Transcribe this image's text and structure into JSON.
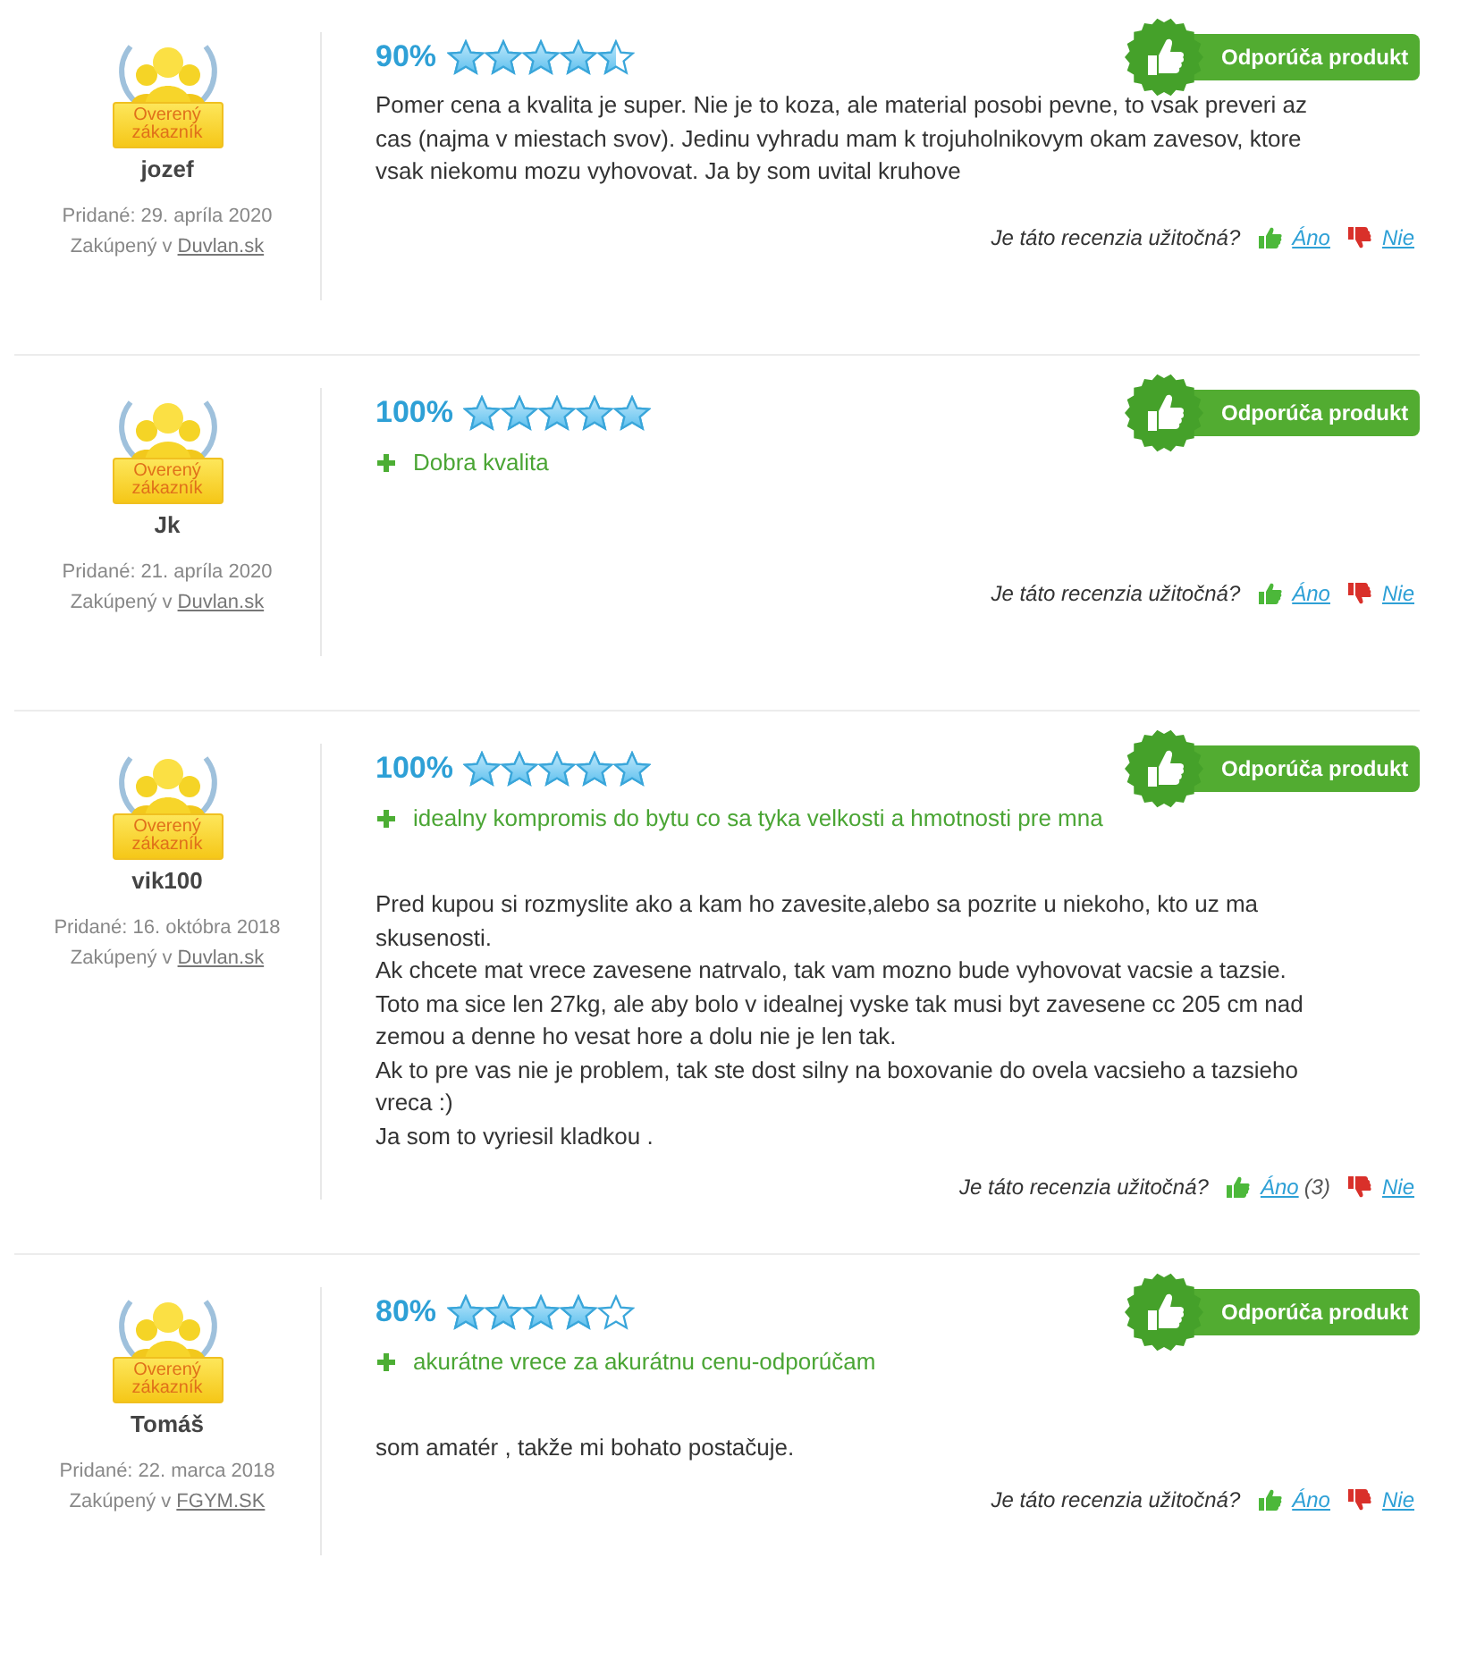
{
  "reviews": [
    {
      "verified_badge": "Overený zákazník",
      "author": "jozef",
      "added": "Pridané: 29. apríla 2020",
      "purchased_label": "Zakúpený v",
      "shop": "Duvlan.sk",
      "percent": "90%",
      "stars": 4.5,
      "recommends": true,
      "recommend_label": "Odporúča produkt",
      "body": [
        "Pomer cena a kvalita je super. Nie je to koza, ale material posobi pevne, to vsak preveri az cas (najma v miestach svov). Jedinu vyhradu mam k trojuholnikovym okam zavesov, ktore vsak niekomu mozu vyhovovat. Ja by som uvital kruhove"
      ],
      "helpful_question": "Je táto recenzia užitočná?",
      "yes": "Áno",
      "no": "Nie"
    },
    {
      "verified_badge": "Overený zákazník",
      "author": "Jk",
      "added": "Pridané: 21. apríla 2020",
      "purchased_label": "Zakúpený v",
      "shop": "Duvlan.sk",
      "percent": "100%",
      "stars": 5,
      "recommends": true,
      "recommend_label": "Odporúča produkt",
      "pros": [
        "Dobra kvalita"
      ],
      "helpful_question": "Je táto recenzia užitočná?",
      "yes": "Áno",
      "no": "Nie"
    },
    {
      "verified_badge": "Overený zákazník",
      "author": "vik100",
      "added": "Pridané: 16. októbra 2018",
      "purchased_label": "Zakúpený v",
      "shop": "Duvlan.sk",
      "percent": "100%",
      "stars": 5,
      "recommends": true,
      "recommend_label": "Odporúča produkt",
      "pros": [
        "idealny kompromis do bytu co sa tyka velkosti a hmotnosti pre mna"
      ],
      "body": [
        "Pred kupou si rozmyslite ako a kam ho zavesite,alebo sa pozrite u niekoho, kto uz ma skusenosti.",
        "Ak chcete mat vrece zavesene natrvalo, tak vam mozno bude vyhovovat vacsie a tazsie. Toto ma sice len 27kg, ale aby bolo v idealnej vyske tak musi byt zavesene cc 205 cm nad zemou a denne ho vesat hore a dolu nie je len tak.",
        "Ak to pre vas nie je problem, tak ste dost silny na boxovanie do ovela vacsieho a tazsieho vreca :)",
        "Ja som to vyriesil kladkou ."
      ],
      "helpful_question": "Je táto recenzia užitočná?",
      "yes": "Áno",
      "yes_count": "(3)",
      "no": "Nie"
    },
    {
      "verified_badge": "Overený zákazník",
      "author": "Tomáš",
      "added": "Pridané: 22. marca 2018",
      "purchased_label": "Zakúpený v",
      "shop": "FGYM.SK",
      "percent": "80%",
      "stars": 4,
      "recommends": true,
      "recommend_label": "Odporúča produkt",
      "pros": [
        "akurátne vrece za akurátnu cenu-odporúčam"
      ],
      "body": [
        "som amatér , takže mi bohato postačuje."
      ],
      "helpful_question": "Je táto recenzia užitočná?",
      "yes": "Áno",
      "no": "Nie"
    }
  ]
}
